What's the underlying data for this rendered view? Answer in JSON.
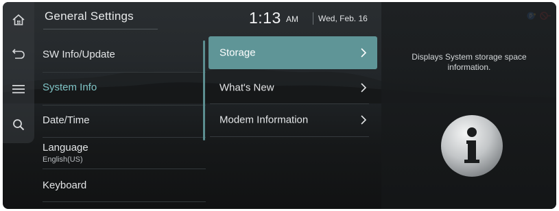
{
  "header": {
    "title": "General Settings",
    "time": "1:13",
    "ampm": "AM",
    "date": "Wed, Feb. 16"
  },
  "rail": {
    "buttons": [
      {
        "name": "home-icon"
      },
      {
        "name": "back-icon"
      },
      {
        "name": "menu-icon"
      },
      {
        "name": "search-icon"
      }
    ]
  },
  "menu": {
    "items": [
      {
        "label": "SW Info/Update"
      },
      {
        "label": "System Info",
        "selected": true
      },
      {
        "label": "Date/Time"
      },
      {
        "label": "Language",
        "sub": "English(US)"
      },
      {
        "label": "Keyboard"
      }
    ]
  },
  "system_info": {
    "items": [
      {
        "label": "Storage",
        "active": true
      },
      {
        "label": "What's New"
      },
      {
        "label": "Modem Information"
      }
    ]
  },
  "detail": {
    "description": "Displays System storage space information.",
    "icon": "info-icon"
  },
  "status": {
    "icons": [
      "bluetooth-phone-icon",
      "no-signal-icon"
    ],
    "colors": {
      "bluetooth": "#3d7fd6",
      "alert": "#d23a3a"
    }
  },
  "theme": {
    "accent": "#5f9597",
    "selected_text": "#7fc4c6"
  }
}
